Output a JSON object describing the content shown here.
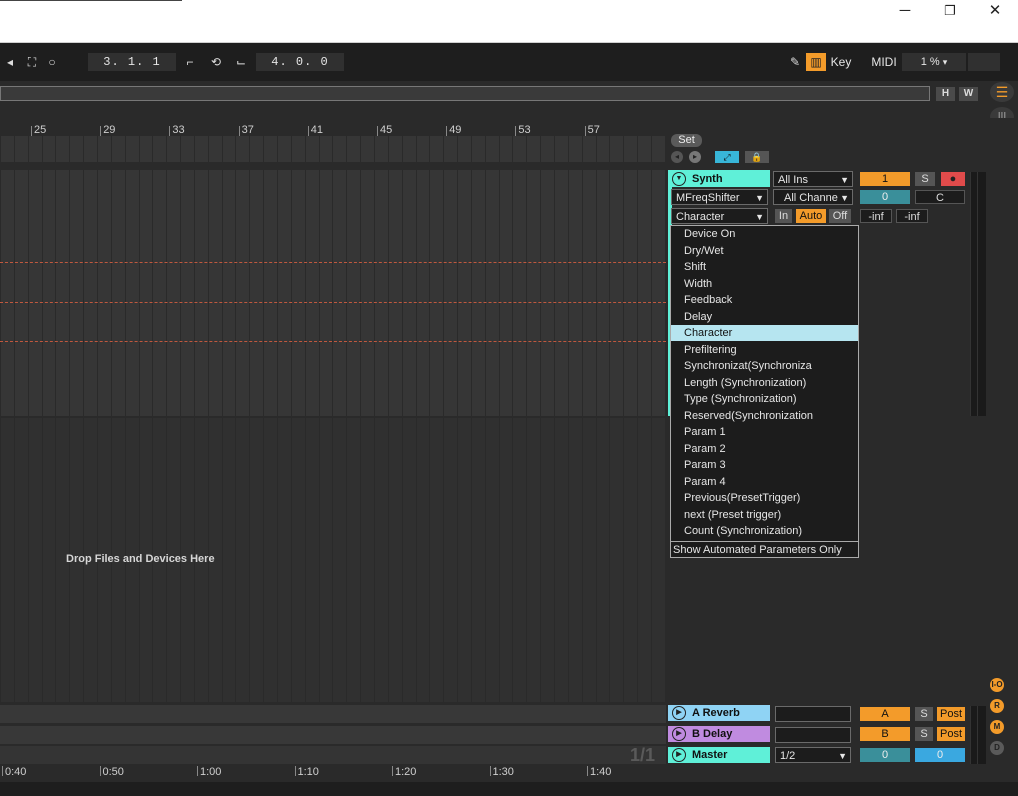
{
  "window": {
    "minimize_icon": "─",
    "restore_icon": "❐",
    "close_icon": "✕"
  },
  "transport": {
    "position": "3. 1. 1",
    "loop_length": "4. 0. 0",
    "key_label": "Key",
    "midi_label": "MIDI",
    "cpu": "1 %"
  },
  "overview": {
    "h_label": "H",
    "w_label": "W"
  },
  "ruler": {
    "bars": [
      "25",
      "29",
      "33",
      "37",
      "41",
      "45",
      "49",
      "53",
      "57"
    ]
  },
  "set_button": "Set",
  "drop_text": "Drop Files and Devices Here",
  "page_indicator": "1/1",
  "time_ruler": [
    "0:40",
    "0:50",
    "1:00",
    "1:10",
    "1:20",
    "1:30",
    "1:40"
  ],
  "synth_track": {
    "name": "Synth",
    "input": "All Ins",
    "device": "MFreqShifter",
    "channel": "All Channe",
    "parameter": "Character",
    "track_number": "1",
    "solo": "S",
    "pan": "0",
    "pan_label": "C",
    "monitor_in": "In",
    "monitor_auto": "Auto",
    "monitor_off": "Off",
    "peak_left": "-inf",
    "peak_right": "-inf"
  },
  "parameter_menu": {
    "items": [
      "Device On",
      "Dry/Wet",
      "Shift",
      "Width",
      "Feedback",
      "Delay",
      "Character",
      "Prefiltering",
      "Synchronizat(Synchroniza",
      "Length (Synchronization)",
      "Type (Synchronization)",
      "Reserved(Synchronization",
      "Param 1",
      "Param 2",
      "Param 3",
      "Param 4",
      "Previous(PresetTrigger)",
      "next (Preset trigger)",
      "Count (Synchronization)"
    ],
    "selected": "Character",
    "footer": "Show Automated Parameters Only"
  },
  "return_tracks": [
    {
      "name": "A Reverb",
      "letter": "A",
      "solo": "S",
      "send": "Post",
      "color": "#8fd3f4"
    },
    {
      "name": "B Delay",
      "letter": "B",
      "solo": "S",
      "send": "Post",
      "color": "#c08be0"
    }
  ],
  "master": {
    "name": "Master",
    "output": "1/2",
    "value_left": "0",
    "value_right": "0"
  },
  "side_buttons": [
    "I-O",
    "R",
    "M",
    "D"
  ],
  "colors": {
    "accent": "#f39b2a",
    "synth": "#5ff0d8",
    "selected_item": "#b6e5f0"
  }
}
